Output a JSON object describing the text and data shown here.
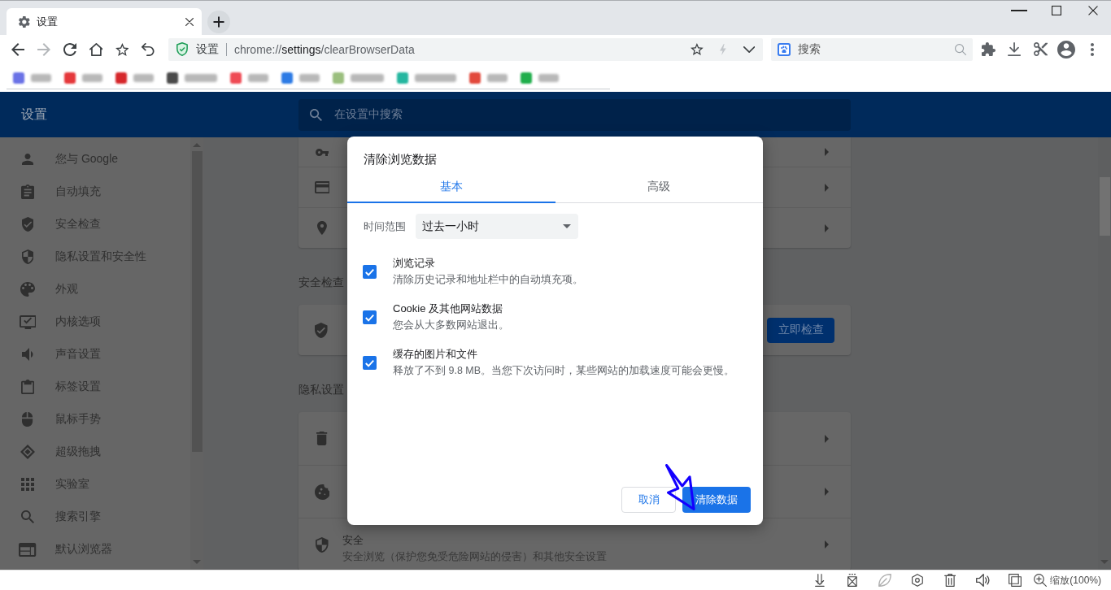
{
  "window": {
    "tab": {
      "title": "设置"
    }
  },
  "toolbar": {
    "nav": [
      {
        "kind": "back",
        "disabled": false
      },
      {
        "kind": "forward",
        "disabled": true
      },
      {
        "kind": "reload",
        "disabled": false
      },
      {
        "kind": "home",
        "disabled": false
      },
      {
        "kind": "star",
        "disabled": false
      },
      {
        "kind": "undo",
        "disabled": false
      }
    ],
    "address": {
      "site_label": "设置",
      "url": {
        "scheme": "chrome://",
        "host": "settings",
        "path": "/clearBrowserData"
      },
      "actions": [
        {
          "kind": "star",
          "disabled": false
        },
        {
          "kind": "bolt",
          "disabled": true
        },
        {
          "kind": "chevron",
          "disabled": false
        }
      ]
    },
    "search": {
      "placeholder": "搜索"
    },
    "extensions": [
      {
        "kind": "puzzle"
      },
      {
        "kind": "download"
      },
      {
        "kind": "scissors"
      },
      {
        "kind": "account"
      },
      {
        "kind": "menu"
      }
    ]
  },
  "bookmarks": [
    {
      "color": "#6a72e6"
    },
    {
      "color": "#e5383b"
    },
    {
      "color": "#d6272b"
    },
    {
      "color": "#4a4a4a"
    },
    {
      "color": "#ef4b55"
    },
    {
      "color": "#2d7be5"
    },
    {
      "color": "#9bbf7e"
    },
    {
      "color": "#25b7a0"
    },
    {
      "color": "#e2493c"
    },
    {
      "color": "#1fae4b"
    }
  ],
  "settings": {
    "header": {
      "title": "设置",
      "search_placeholder": "在设置中搜索"
    },
    "sidebar": [
      {
        "kind": "person",
        "label": "您与 Google"
      },
      {
        "kind": "autofill",
        "label": "自动填充"
      },
      {
        "kind": "safety",
        "label": "安全检查"
      },
      {
        "kind": "privacy",
        "label": "隐私设置和安全性"
      },
      {
        "kind": "palette",
        "label": "外观"
      },
      {
        "kind": "monitor",
        "label": "内核选项"
      },
      {
        "kind": "sound",
        "label": "声音设置"
      },
      {
        "kind": "tabs",
        "label": "标签设置"
      },
      {
        "kind": "mouse",
        "label": "鼠标手势"
      },
      {
        "kind": "drag",
        "label": "超级拖拽"
      },
      {
        "kind": "apps",
        "label": "实验室"
      },
      {
        "kind": "search",
        "label": "搜索引擎"
      },
      {
        "kind": "browser",
        "label": "默认浏览器"
      }
    ],
    "sections": [
      {
        "kind": "rows",
        "rows": [
          {
            "kind": "key"
          },
          {
            "kind": "card"
          },
          {
            "kind": "pin"
          }
        ]
      },
      {
        "kind": "safety",
        "heading": "安全检查",
        "button": "立即检查"
      },
      {
        "kind": "rows",
        "heading": "隐私设置",
        "rows": [
          {
            "kind": "trash"
          },
          {
            "kind": "cookie"
          },
          {
            "kind": "shield",
            "title": "安全",
            "description": "安全浏览（保护您免受危险网站的侵害）和其他安全设置"
          }
        ]
      }
    ]
  },
  "dialog": {
    "title": "清除浏览数据",
    "tabs": [
      {
        "label": "基本",
        "selected": true
      },
      {
        "label": "高级",
        "selected": false
      }
    ],
    "time_range": {
      "label": "时间范围",
      "value": "过去一小时"
    },
    "options": [
      {
        "title": "浏览记录",
        "description": "清除历史记录和地址栏中的自动填充项。",
        "checked": true
      },
      {
        "title": "Cookie 及其他网站数据",
        "description": "您会从大多数网站退出。",
        "checked": true
      },
      {
        "title": "缓存的图片和文件",
        "description": "释放了不到 9.8 MB。当您下次访问时，某些网站的加载速度可能会更慢。",
        "checked": true
      }
    ],
    "buttons": [
      {
        "kind": "cancel",
        "label": "取消"
      },
      {
        "kind": "confirm",
        "label": "清除数据"
      }
    ]
  },
  "status_bar": {
    "tools": [
      {
        "kind": "download",
        "disabled": false
      },
      {
        "kind": "block",
        "disabled": false
      },
      {
        "kind": "leaf",
        "disabled": true
      },
      {
        "kind": "hexagon",
        "disabled": false
      },
      {
        "kind": "trash",
        "disabled": false
      },
      {
        "kind": "sound",
        "disabled": false
      },
      {
        "kind": "windows",
        "disabled": false
      }
    ],
    "zoom": "缩放(100%)"
  }
}
